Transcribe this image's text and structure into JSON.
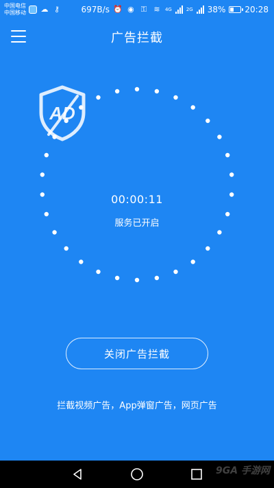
{
  "status_bar": {
    "carrier_1": "中国电信",
    "carrier_2": "中国移动",
    "net_speed": "697B/s",
    "network_1": "4G",
    "network_2": "2G",
    "battery": "38%",
    "battery_level": 0.38,
    "time": "20:28"
  },
  "header": {
    "title": "广告拦截"
  },
  "status": {
    "timer": "00:00:11",
    "service_text": "服务已开启",
    "badge_text": "AD"
  },
  "actions": {
    "toggle_label": "关闭广告拦截"
  },
  "description": "拦截视频广告，App弹窗广告，网页广告",
  "watermark": "9GA 手游网",
  "colors": {
    "background": "#1e86f3",
    "foreground": "#ffffff",
    "nav_bar": "#000000"
  },
  "icons": {
    "menu": "hamburger-menu-icon",
    "shield": "ad-block-shield-icon",
    "nav_back": "triangle-back-icon",
    "nav_home": "circle-home-icon",
    "nav_recents": "square-recents-icon"
  }
}
